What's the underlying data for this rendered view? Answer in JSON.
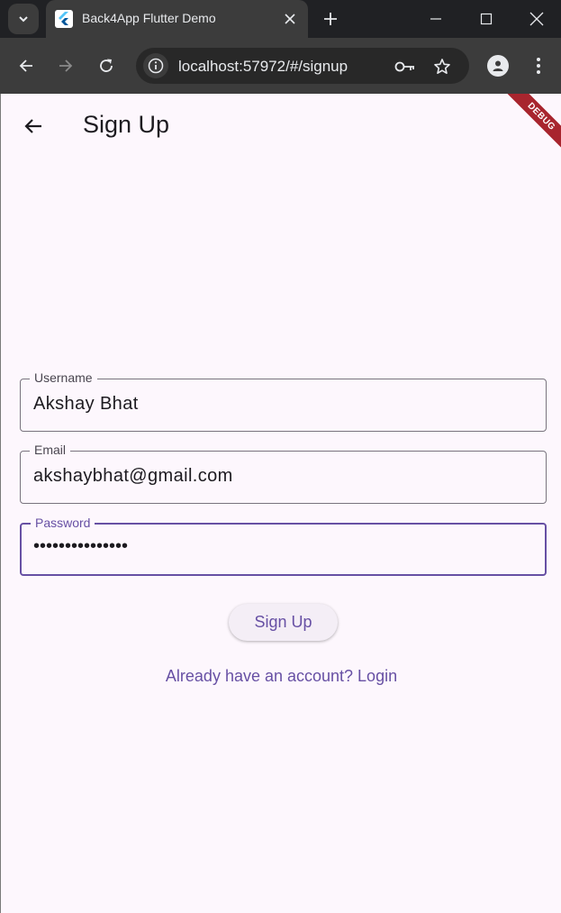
{
  "browser": {
    "tab_title": "Back4App Flutter Demo",
    "url": "localhost:57972/#/signup",
    "icons": {
      "tab_search": "chevron-down-icon",
      "favicon": "flutter-icon",
      "tab_close": "close-icon",
      "new_tab": "plus-icon",
      "minimize": "minimize-icon",
      "maximize": "maximize-icon",
      "close_window": "close-icon",
      "back": "arrow-left-icon",
      "forward": "arrow-right-icon",
      "reload": "reload-icon",
      "site_info": "info-icon",
      "password_key": "key-icon",
      "bookmark": "star-icon",
      "profile": "person-icon",
      "menu": "kebab-icon"
    }
  },
  "app": {
    "title": "Sign Up",
    "debug_banner": "DEBUG",
    "back_icon": "arrow-back-icon",
    "fields": {
      "username": {
        "label": "Username",
        "value": "Akshay Bhat"
      },
      "email": {
        "label": "Email",
        "value": "akshaybhat@gmail.com"
      },
      "password": {
        "label": "Password",
        "value": "•••••••••••••••"
      }
    },
    "signup_button": "Sign Up",
    "login_link": "Already have an account? Login"
  },
  "colors": {
    "primary": "#6750a4",
    "surface": "#fdf7fd",
    "chrome_dark": "#202124",
    "chrome_toolbar": "#3c3c3c",
    "debug": "#a8252e"
  }
}
